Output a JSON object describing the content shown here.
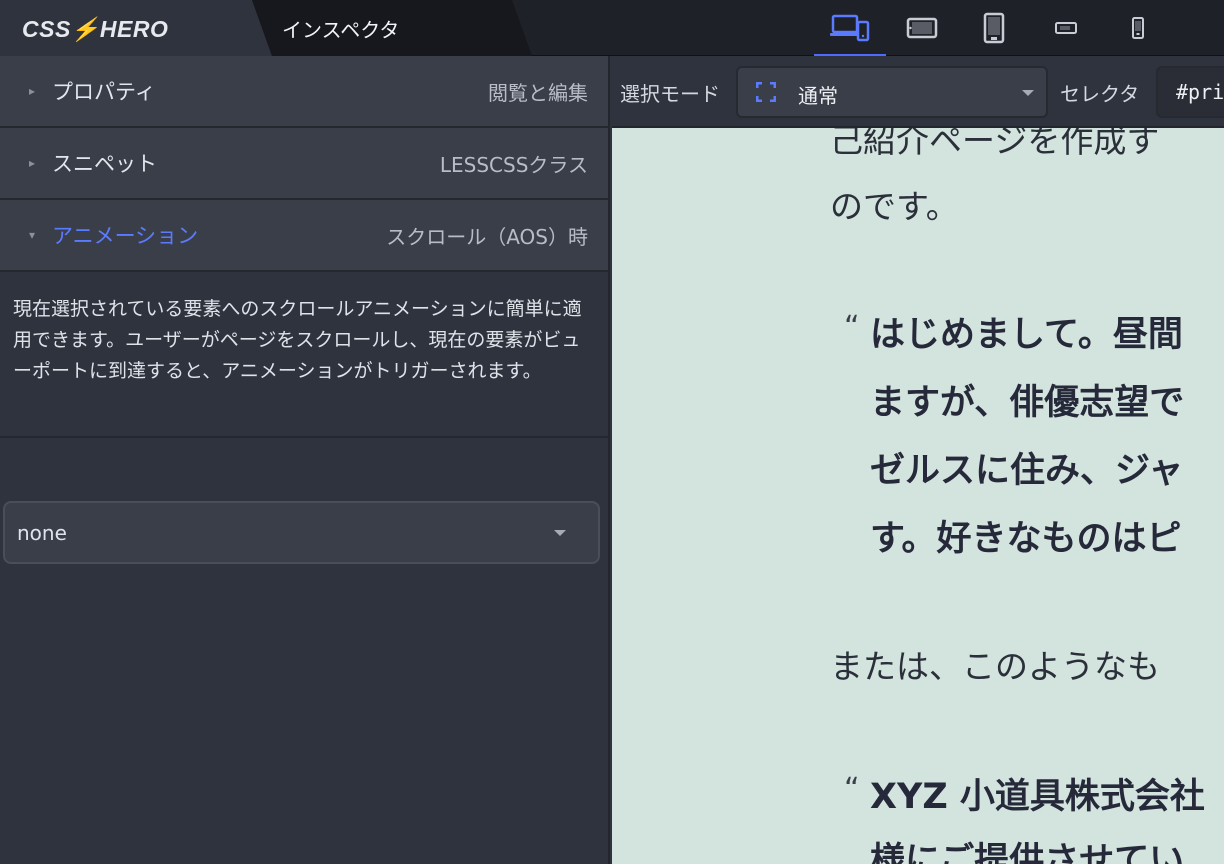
{
  "app": {
    "logo": "CSS⚡HERO",
    "inspector_tab": "インスペクタ"
  },
  "devices": [
    {
      "name": "desktop-mobile",
      "active": true
    },
    {
      "name": "tablet-landscape",
      "active": false
    },
    {
      "name": "tablet-portrait",
      "active": false
    },
    {
      "name": "phone-landscape",
      "active": false
    },
    {
      "name": "phone-portrait",
      "active": false
    }
  ],
  "sidebar": {
    "sections": [
      {
        "title": "プロパティ",
        "subtitle": "閲覧と編集",
        "expanded": false
      },
      {
        "title": "スニペット",
        "subtitle": "LESSCSSクラス",
        "expanded": false
      },
      {
        "title": "アニメーション",
        "subtitle": "スクロール（AOS）時",
        "expanded": true
      }
    ],
    "description": "現在選択されている要素へのスクロールアニメーションに簡単に適用できます。ユーザーがページをスクロールし、現在の要素がビューポートに到達すると、アニメーションがトリガーされます。",
    "animation_select": "none"
  },
  "toolbar": {
    "mode_label": "選択モード",
    "mode_value": "通常",
    "selector_label": "セレクタ",
    "selector_value": "#pri"
  },
  "preview": {
    "line1": "己紹介ページを作成す",
    "line2": "のです。",
    "quote1_mark": "“",
    "quote1": [
      "はじめまして。昼間",
      "ますが、俳優志望で",
      "ゼルスに住み、ジャ",
      "す。好きなものはピ"
    ],
    "line3": "または、このようなも",
    "quote2_mark": "“",
    "quote2": [
      "XYZ 小道具株式会社",
      "様にご提供させてい"
    ]
  },
  "colors": {
    "accent": "#5b7bff",
    "panel": "#2f333d",
    "preview_bg": "#d3e3dd"
  }
}
